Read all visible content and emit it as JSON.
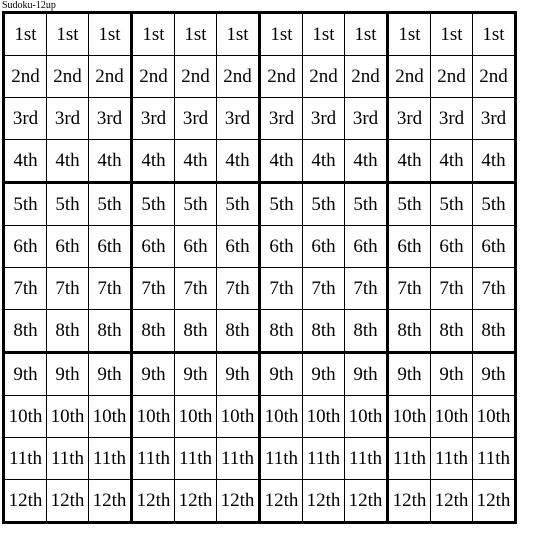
{
  "page": {
    "title": "Sudoku-12up",
    "background_color": "#ffffff",
    "text_color": "#000000",
    "border_color": "#000000"
  },
  "grid": {
    "rows": 12,
    "columns": 12,
    "box_rows": 4,
    "box_columns": 3,
    "cell_background": "#ffffff",
    "thin_border_px": 1,
    "thick_border_px": 3,
    "row_labels": [
      "1st",
      "2nd",
      "3rd",
      "4th",
      "5th",
      "6th",
      "7th",
      "8th",
      "9th",
      "10th",
      "11th",
      "12th"
    ],
    "cells": [
      [
        "1st",
        "1st",
        "1st",
        "1st",
        "1st",
        "1st",
        "1st",
        "1st",
        "1st",
        "1st",
        "1st",
        "1st"
      ],
      [
        "2nd",
        "2nd",
        "2nd",
        "2nd",
        "2nd",
        "2nd",
        "2nd",
        "2nd",
        "2nd",
        "2nd",
        "2nd",
        "2nd"
      ],
      [
        "3rd",
        "3rd",
        "3rd",
        "3rd",
        "3rd",
        "3rd",
        "3rd",
        "3rd",
        "3rd",
        "3rd",
        "3rd",
        "3rd"
      ],
      [
        "4th",
        "4th",
        "4th",
        "4th",
        "4th",
        "4th",
        "4th",
        "4th",
        "4th",
        "4th",
        "4th",
        "4th"
      ],
      [
        "5th",
        "5th",
        "5th",
        "5th",
        "5th",
        "5th",
        "5th",
        "5th",
        "5th",
        "5th",
        "5th",
        "5th"
      ],
      [
        "6th",
        "6th",
        "6th",
        "6th",
        "6th",
        "6th",
        "6th",
        "6th",
        "6th",
        "6th",
        "6th",
        "6th"
      ],
      [
        "7th",
        "7th",
        "7th",
        "7th",
        "7th",
        "7th",
        "7th",
        "7th",
        "7th",
        "7th",
        "7th",
        "7th"
      ],
      [
        "8th",
        "8th",
        "8th",
        "8th",
        "8th",
        "8th",
        "8th",
        "8th",
        "8th",
        "8th",
        "8th",
        "8th"
      ],
      [
        "9th",
        "9th",
        "9th",
        "9th",
        "9th",
        "9th",
        "9th",
        "9th",
        "9th",
        "9th",
        "9th",
        "9th"
      ],
      [
        "10th",
        "10th",
        "10th",
        "10th",
        "10th",
        "10th",
        "10th",
        "10th",
        "10th",
        "10th",
        "10th",
        "10th"
      ],
      [
        "11th",
        "11th",
        "11th",
        "11th",
        "11th",
        "11th",
        "11th",
        "11th",
        "11th",
        "11th",
        "11th",
        "11th"
      ],
      [
        "12th",
        "12th",
        "12th",
        "12th",
        "12th",
        "12th",
        "12th",
        "12th",
        "12th",
        "12th",
        "12th",
        "12th"
      ]
    ]
  }
}
